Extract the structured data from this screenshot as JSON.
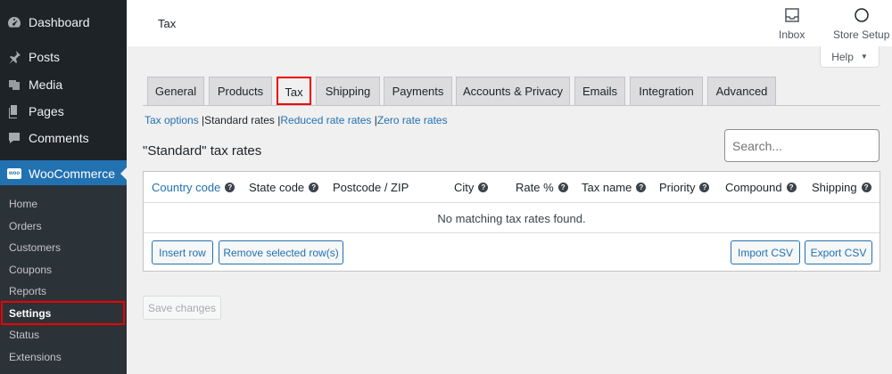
{
  "sidebar": {
    "menu": [
      {
        "label": "Dashboard",
        "icon": "dashboard-icon"
      },
      {
        "label": "Posts",
        "icon": "pin-icon"
      },
      {
        "label": "Media",
        "icon": "media-icon"
      },
      {
        "label": "Pages",
        "icon": "pages-icon"
      },
      {
        "label": "Comments",
        "icon": "comments-icon"
      },
      {
        "label": "WooCommerce",
        "icon": "woo-icon"
      }
    ],
    "woo_logo_text": "woo",
    "submenu": [
      "Home",
      "Orders",
      "Customers",
      "Coupons",
      "Reports",
      "Settings",
      "Status",
      "Extensions"
    ]
  },
  "header": {
    "title": "Tax",
    "inbox_label": "Inbox",
    "store_setup_label": "Store Setup",
    "help_label": "Help"
  },
  "tabs": [
    "General",
    "Products",
    "Tax",
    "Shipping",
    "Payments",
    "Accounts & Privacy",
    "Emails",
    "Integration",
    "Advanced"
  ],
  "sublinks": {
    "tax_options": "Tax options",
    "standard": "Standard rates",
    "reduced": "Reduced rate rates",
    "zero": "Zero rate rates",
    "sep": "|"
  },
  "section_title": "\"Standard\" tax rates",
  "search": {
    "placeholder": "Search..."
  },
  "table": {
    "columns": [
      "Country code",
      "State code",
      "Postcode / ZIP",
      "City",
      "Rate %",
      "Tax name",
      "Priority",
      "Compound",
      "Shipping"
    ],
    "empty_message": "No matching tax rates found.",
    "insert_row": "Insert row",
    "remove_rows": "Remove selected row(s)",
    "import_csv": "Import CSV",
    "export_csv": "Export CSV"
  },
  "save_changes": "Save changes",
  "colors": {
    "accent": "#2271b1",
    "sidebar": "#1d2327",
    "highlight": "#ee0000"
  }
}
